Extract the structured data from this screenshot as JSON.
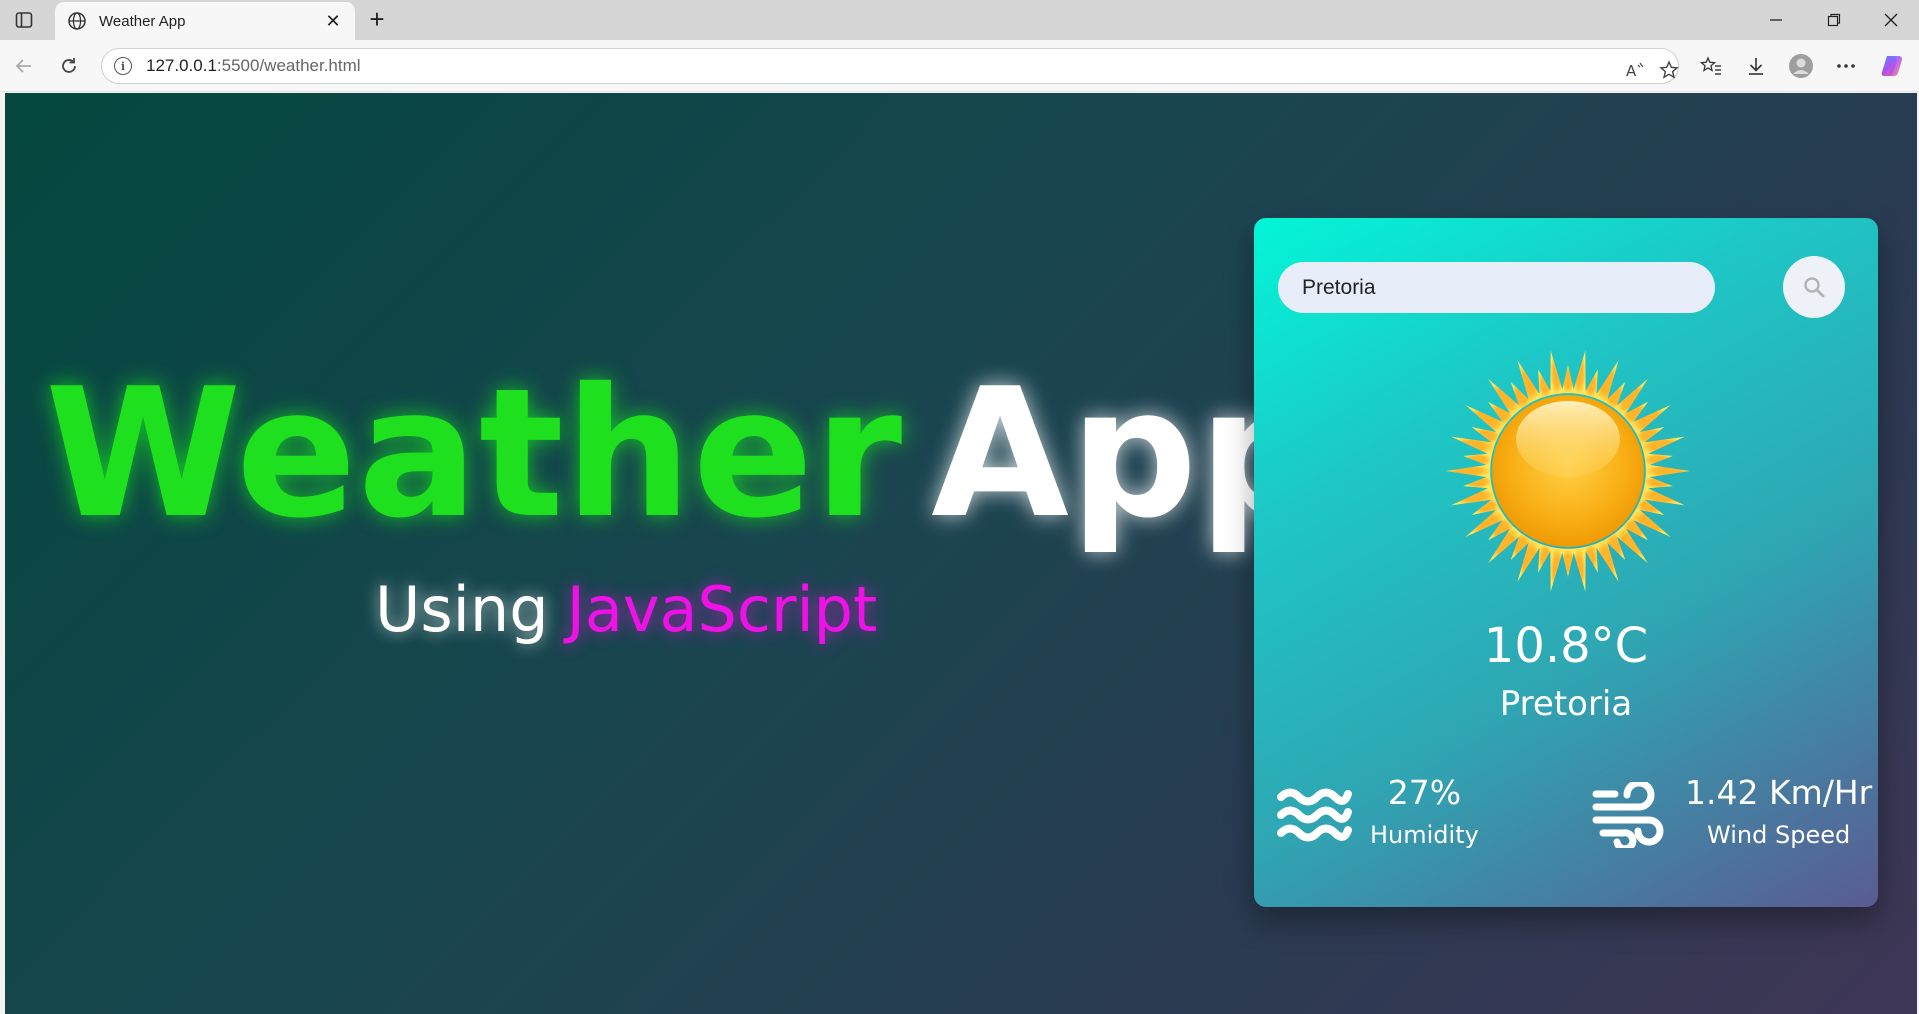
{
  "browser": {
    "tab_title": "Weather App",
    "tab_close": "✕",
    "new_tab": "+",
    "url_host": "127.0.0.1",
    "url_rest": ":5500/weather.html"
  },
  "hero": {
    "title_part1": "Weather",
    "title_part2": "App",
    "subtitle_part1": "Using",
    "subtitle_part2": "JavaScript"
  },
  "card": {
    "search_value": "Pretoria",
    "temperature": "10.8°C",
    "city": "Pretoria",
    "humidity_value": "27%",
    "humidity_label": "Humidity",
    "wind_value": "1.42 Km/Hr",
    "wind_label": "Wind Speed",
    "weather_icon": "sun-icon"
  },
  "colors": {
    "title_green": "#1fe01f",
    "subtitle_magenta": "#ee12e6",
    "card_gradient_start": "#03f5d8",
    "card_gradient_end": "#5a5b92"
  }
}
